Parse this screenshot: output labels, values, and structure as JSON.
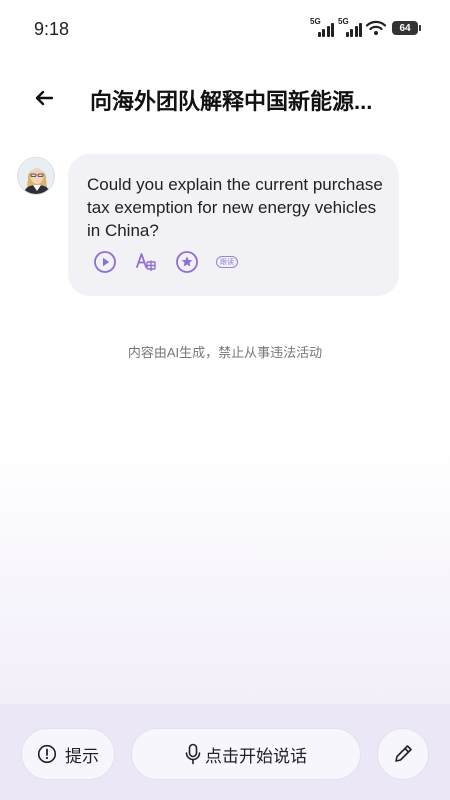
{
  "status": {
    "time": "9:18",
    "signal1_label": "5G",
    "signal2_label": "5G",
    "battery": "64"
  },
  "header": {
    "title": "向海外团队解释中国新能源..."
  },
  "message": {
    "text": "Could you explain the current purchase tax exemption for new energy vehicles in China?",
    "actions": {
      "play": "play-icon",
      "translate": "translate-icon",
      "favorite": "star-icon",
      "badge": "跟读"
    }
  },
  "disclaimer": "内容由AI生成，禁止从事违法活动",
  "bottom": {
    "hint_label": "提示",
    "speak_label": "点击开始说话",
    "edit": "pencil-icon"
  },
  "colors": {
    "accent": "#8f6fd6",
    "bubble": "#f1f1f6",
    "bottom_bar": "#ebe7f7"
  }
}
